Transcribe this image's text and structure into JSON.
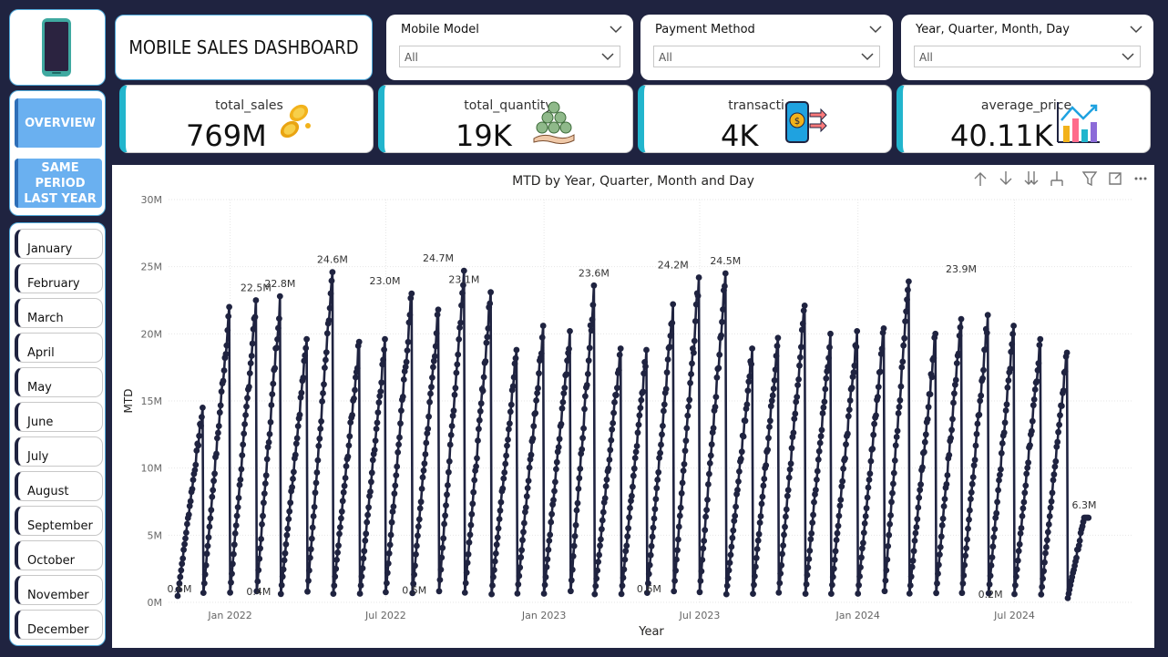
{
  "header": {
    "title": "MOBILE SALES DASHBOARD"
  },
  "nav": {
    "overview": "OVERVIEW",
    "same_period_line1": "SAME PERIOD",
    "same_period_line2": "LAST YEAR"
  },
  "months": [
    "January",
    "February",
    "March",
    "April",
    "May",
    "June",
    "July",
    "August",
    "September",
    "October",
    "November",
    "December"
  ],
  "filters": [
    {
      "title": "Mobile Model",
      "value": "All"
    },
    {
      "title": "Payment Method",
      "value": "All"
    },
    {
      "title": "Year, Quarter, Month, Day",
      "value": "All"
    }
  ],
  "kpis": [
    {
      "label": "total_sales",
      "value": "769M",
      "icon": "coins-icon"
    },
    {
      "label": "total_quantity",
      "value": "19K",
      "icon": "money-stack-hand-icon"
    },
    {
      "label": "transactions",
      "value": "4K",
      "icon": "phone-payment-icon"
    },
    {
      "label": "average_price",
      "value": "40.11K",
      "icon": "bar-chart-icon"
    }
  ],
  "toolbar": {
    "icons": [
      "arrow-up-icon",
      "arrow-down-icon",
      "double-arrow-down-icon",
      "expand-hierarchy-icon",
      "filter-icon",
      "focus-mode-icon",
      "more-options-icon"
    ]
  },
  "chart_data": {
    "type": "line",
    "title": "MTD by Year, Quarter, Month and Day",
    "xlabel": "Year",
    "ylabel": "MTD",
    "ylim": [
      0,
      30
    ],
    "y_ticks": [
      0,
      5,
      10,
      15,
      20,
      25,
      30
    ],
    "y_tick_labels": [
      "0M",
      "5M",
      "10M",
      "15M",
      "20M",
      "25M",
      "30M"
    ],
    "x_ticks": [
      "2022-01",
      "2022-07",
      "2023-01",
      "2023-07",
      "2024-01",
      "2024-07"
    ],
    "x_tick_labels": [
      "Jan 2022",
      "Jul 2022",
      "Jan 2023",
      "Jul 2023",
      "Jan 2024",
      "Jul 2024"
    ],
    "grid": true,
    "marker": "circle",
    "color": "#1f2340",
    "start_month": "2021-11",
    "series": [
      {
        "name": "MTD",
        "monthly_peak_values": [
          14.5,
          22.0,
          22.5,
          22.8,
          19.6,
          24.6,
          19.4,
          19.6,
          23.0,
          21.8,
          24.7,
          23.1,
          18.8,
          20.6,
          20.2,
          23.6,
          18.9,
          18.8,
          22.2,
          24.2,
          24.5,
          18.9,
          19.7,
          22.1,
          20.0,
          20.2,
          20.4,
          23.9,
          20.0,
          21.1,
          21.4,
          20.6,
          19.6,
          18.6,
          6.3
        ]
      }
    ],
    "data_labels": [
      {
        "x": "2021-11-01",
        "y": 0.6,
        "text": "0.6M"
      },
      {
        "x": "2022-01-31",
        "y": 22.5,
        "text": "22.5M"
      },
      {
        "x": "2022-02-01",
        "y": 0.4,
        "text": "0.4M"
      },
      {
        "x": "2022-02-28",
        "y": 22.8,
        "text": "22.8M"
      },
      {
        "x": "2022-04-30",
        "y": 24.6,
        "text": "24.6M"
      },
      {
        "x": "2022-06-30",
        "y": 23.0,
        "text": "23.0M"
      },
      {
        "x": "2022-08-01",
        "y": 0.5,
        "text": "0.5M"
      },
      {
        "x": "2022-08-31",
        "y": 24.7,
        "text": "24.7M"
      },
      {
        "x": "2022-09-30",
        "y": 23.1,
        "text": "23.1M"
      },
      {
        "x": "2023-02-28",
        "y": 23.6,
        "text": "23.6M"
      },
      {
        "x": "2023-05-01",
        "y": 0.6,
        "text": "0.6M"
      },
      {
        "x": "2023-05-31",
        "y": 24.2,
        "text": "24.2M"
      },
      {
        "x": "2023-07-31",
        "y": 24.5,
        "text": "24.5M"
      },
      {
        "x": "2024-04-30",
        "y": 23.9,
        "text": "23.9M"
      },
      {
        "x": "2024-06-01",
        "y": 0.2,
        "text": "0.2M"
      },
      {
        "x": "2024-09-20",
        "y": 6.3,
        "text": "6.3M"
      }
    ]
  }
}
